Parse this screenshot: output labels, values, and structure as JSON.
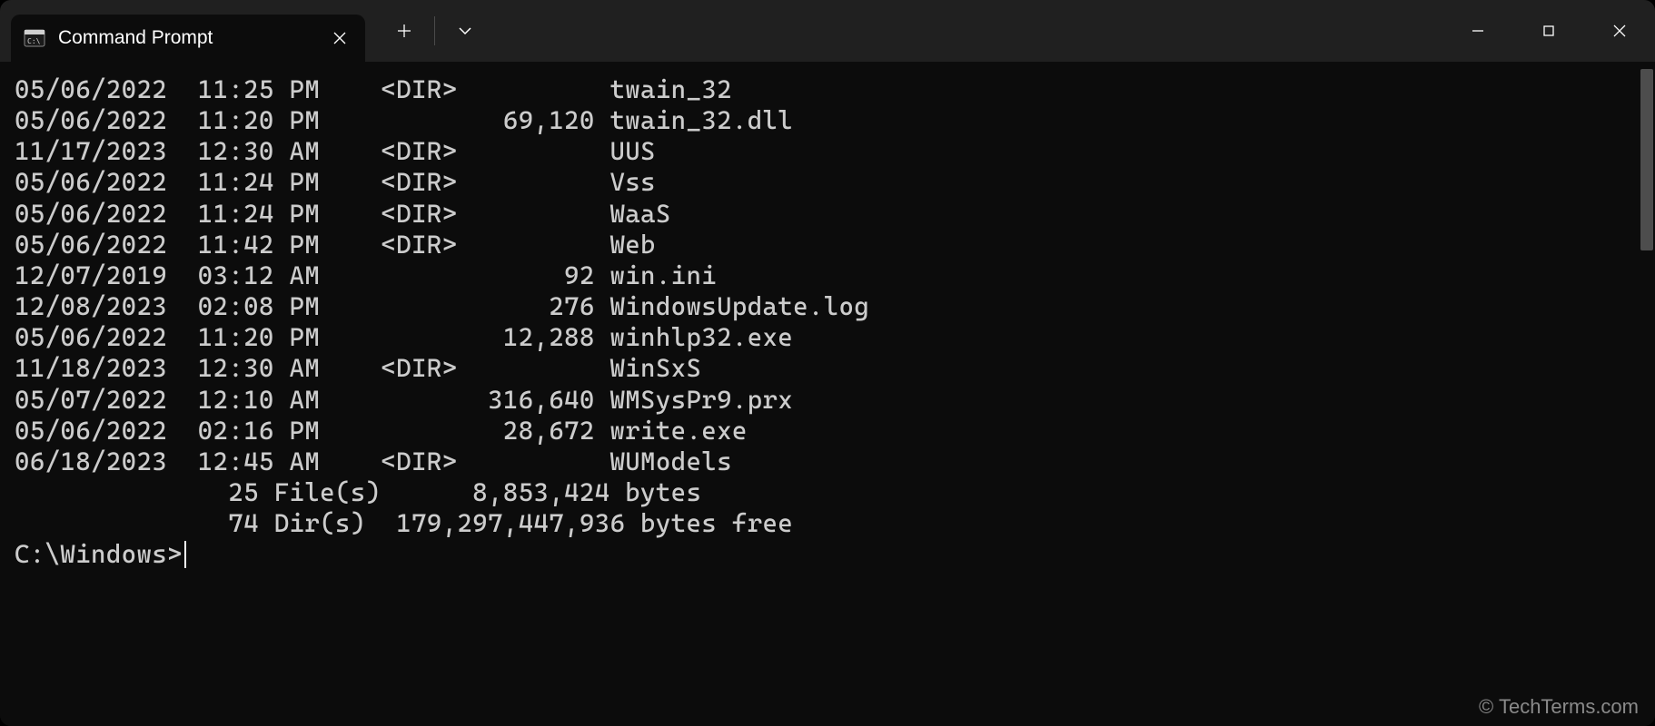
{
  "window": {
    "tab_title": "Command Prompt"
  },
  "listing": [
    {
      "date": "05/06/2022",
      "time": "11:25 PM",
      "type": "<DIR>",
      "size": "",
      "name": "twain_32"
    },
    {
      "date": "05/06/2022",
      "time": "11:20 PM",
      "type": "",
      "size": "69,120",
      "name": "twain_32.dll"
    },
    {
      "date": "11/17/2023",
      "time": "12:30 AM",
      "type": "<DIR>",
      "size": "",
      "name": "UUS"
    },
    {
      "date": "05/06/2022",
      "time": "11:24 PM",
      "type": "<DIR>",
      "size": "",
      "name": "Vss"
    },
    {
      "date": "05/06/2022",
      "time": "11:24 PM",
      "type": "<DIR>",
      "size": "",
      "name": "WaaS"
    },
    {
      "date": "05/06/2022",
      "time": "11:42 PM",
      "type": "<DIR>",
      "size": "",
      "name": "Web"
    },
    {
      "date": "12/07/2019",
      "time": "03:12 AM",
      "type": "",
      "size": "92",
      "name": "win.ini"
    },
    {
      "date": "12/08/2023",
      "time": "02:08 PM",
      "type": "",
      "size": "276",
      "name": "WindowsUpdate.log"
    },
    {
      "date": "05/06/2022",
      "time": "11:20 PM",
      "type": "",
      "size": "12,288",
      "name": "winhlp32.exe"
    },
    {
      "date": "11/18/2023",
      "time": "12:30 AM",
      "type": "<DIR>",
      "size": "",
      "name": "WinSxS"
    },
    {
      "date": "05/07/2022",
      "time": "12:10 AM",
      "type": "",
      "size": "316,640",
      "name": "WMSysPr9.prx"
    },
    {
      "date": "05/06/2022",
      "time": "02:16 PM",
      "type": "",
      "size": "28,672",
      "name": "write.exe"
    },
    {
      "date": "06/18/2023",
      "time": "12:45 AM",
      "type": "<DIR>",
      "size": "",
      "name": "WUModels"
    }
  ],
  "summary": {
    "files_line": "              25 File(s)      8,853,424 bytes",
    "dirs_line": "              74 Dir(s)  179,297,447,936 bytes free"
  },
  "prompt": "C:\\Windows>",
  "watermark": "© TechTerms.com"
}
